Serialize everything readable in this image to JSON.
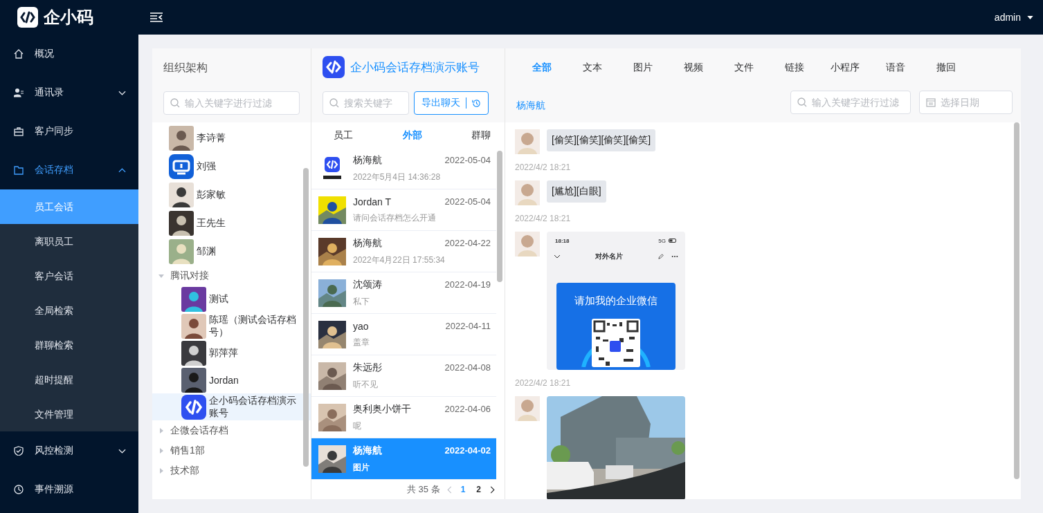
{
  "header": {
    "logo_text": "企小码",
    "user": "admin"
  },
  "sidebar": {
    "items": [
      {
        "label": "概况"
      },
      {
        "label": "通讯录",
        "expanded": false
      },
      {
        "label": "客户同步"
      },
      {
        "label": "会话存档",
        "expanded": true,
        "children": [
          {
            "label": "员工会话",
            "selected": true
          },
          {
            "label": "离职员工",
            "selected": false
          },
          {
            "label": "客户会话",
            "selected": false
          },
          {
            "label": "全局检索",
            "selected": false
          },
          {
            "label": "群聊检索",
            "selected": false
          },
          {
            "label": "超时提醒",
            "selected": false
          },
          {
            "label": "文件管理",
            "selected": false
          }
        ]
      },
      {
        "label": "风控检测",
        "expanded": false
      },
      {
        "label": "事件溯源"
      }
    ]
  },
  "org": {
    "title": "组织架构",
    "search": {
      "placeholder": "输入关键字进行过滤"
    },
    "tree": [
      {
        "label": "李诗菁",
        "kind": "picture",
        "selected": false
      },
      {
        "label": "刘强",
        "kind": "app",
        "selected": false
      },
      {
        "label": "彭家敏",
        "kind": "picture",
        "selected": false
      },
      {
        "label": "王先生",
        "kind": "picture",
        "selected": false
      },
      {
        "label": "邹渊",
        "kind": "picture",
        "selected": false
      },
      {
        "label": "腾讯对接",
        "expanded": true,
        "children": [
          {
            "label": "测试",
            "kind": "picture",
            "selected": false
          },
          {
            "label": "陈瑶（测试会话存档号）",
            "kind": "picture",
            "selected": false
          },
          {
            "label": "郭萍萍",
            "kind": "picture",
            "selected": false
          },
          {
            "label": "Jordan",
            "kind": "picture",
            "selected": false
          },
          {
            "label": "企小码会话存档演示账号",
            "kind": "logo",
            "selected": true
          }
        ]
      },
      {
        "label": "企微会话存档",
        "expanded": false
      },
      {
        "label": "销售1部",
        "expanded": false
      },
      {
        "label": "技术部",
        "expanded": false
      }
    ]
  },
  "chats": {
    "account": "企小码会话存档演示账号",
    "search": {
      "placeholder": "搜索关键字"
    },
    "export_button": "导出聊天",
    "tabs": [
      {
        "label": "员工",
        "selected": false
      },
      {
        "label": "外部",
        "selected": true
      },
      {
        "label": "群聊",
        "selected": false
      }
    ],
    "rows": [
      {
        "name": "杨海航",
        "date": "2022-05-04",
        "preview": "2022年5月4日 14:36:28",
        "kind": "logo",
        "selected": false
      },
      {
        "name": "Jordan T",
        "date": "2022-05-04",
        "preview": "请问会话存档怎么开通",
        "kind": "picture",
        "selected": false
      },
      {
        "name": "杨海航",
        "date": "2022-04-22",
        "preview": "2022年4月22日 17:55:34",
        "kind": "picture",
        "selected": false
      },
      {
        "name": "沈颂涛",
        "date": "2022-04-19",
        "preview": "私下",
        "kind": "picture",
        "selected": false
      },
      {
        "name": "yao",
        "date": "2022-04-11",
        "preview": "盖章",
        "kind": "picture",
        "selected": false
      },
      {
        "name": "朱远彤",
        "date": "2022-04-08",
        "preview": "听不见",
        "kind": "picture",
        "selected": false
      },
      {
        "name": "奥利奥小饼干",
        "date": "2022-04-06",
        "preview": "呢",
        "kind": "picture",
        "selected": false
      },
      {
        "name": "杨海航",
        "date": "2022-04-02",
        "preview": "图片",
        "kind": "picture",
        "selected": true
      }
    ],
    "pagination": {
      "total": "共 35 条",
      "pages": [
        {
          "label": "1",
          "selected": true
        },
        {
          "label": "2",
          "selected": false
        }
      ]
    }
  },
  "detail": {
    "tabs": [
      {
        "label": "全部",
        "selected": true
      },
      {
        "label": "文本",
        "selected": false
      },
      {
        "label": "图片",
        "selected": false
      },
      {
        "label": "视频",
        "selected": false
      },
      {
        "label": "文件",
        "selected": false
      },
      {
        "label": "链接",
        "selected": false
      },
      {
        "label": "小程序",
        "selected": false
      },
      {
        "label": "语音",
        "selected": false
      },
      {
        "label": "撤回",
        "selected": false
      }
    ],
    "contact": "杨海航",
    "search": {
      "placeholder": "输入关键字进行过滤"
    },
    "date": {
      "placeholder": "选择日期"
    },
    "messages": [
      {
        "kind": "text",
        "text": "[偷笑][偷笑][偷笑][偷笑]",
        "time": "2022/4/2 18:21"
      },
      {
        "kind": "text",
        "text": "[尴尬][白眼]",
        "time": "2022/4/2 18:21"
      },
      {
        "kind": "screenshot",
        "clock": "18:18",
        "network": "5G",
        "title": "对外名片",
        "heading": "请加我的企业微信",
        "time": "2022/4/2 18:21"
      },
      {
        "kind": "picture"
      }
    ]
  }
}
